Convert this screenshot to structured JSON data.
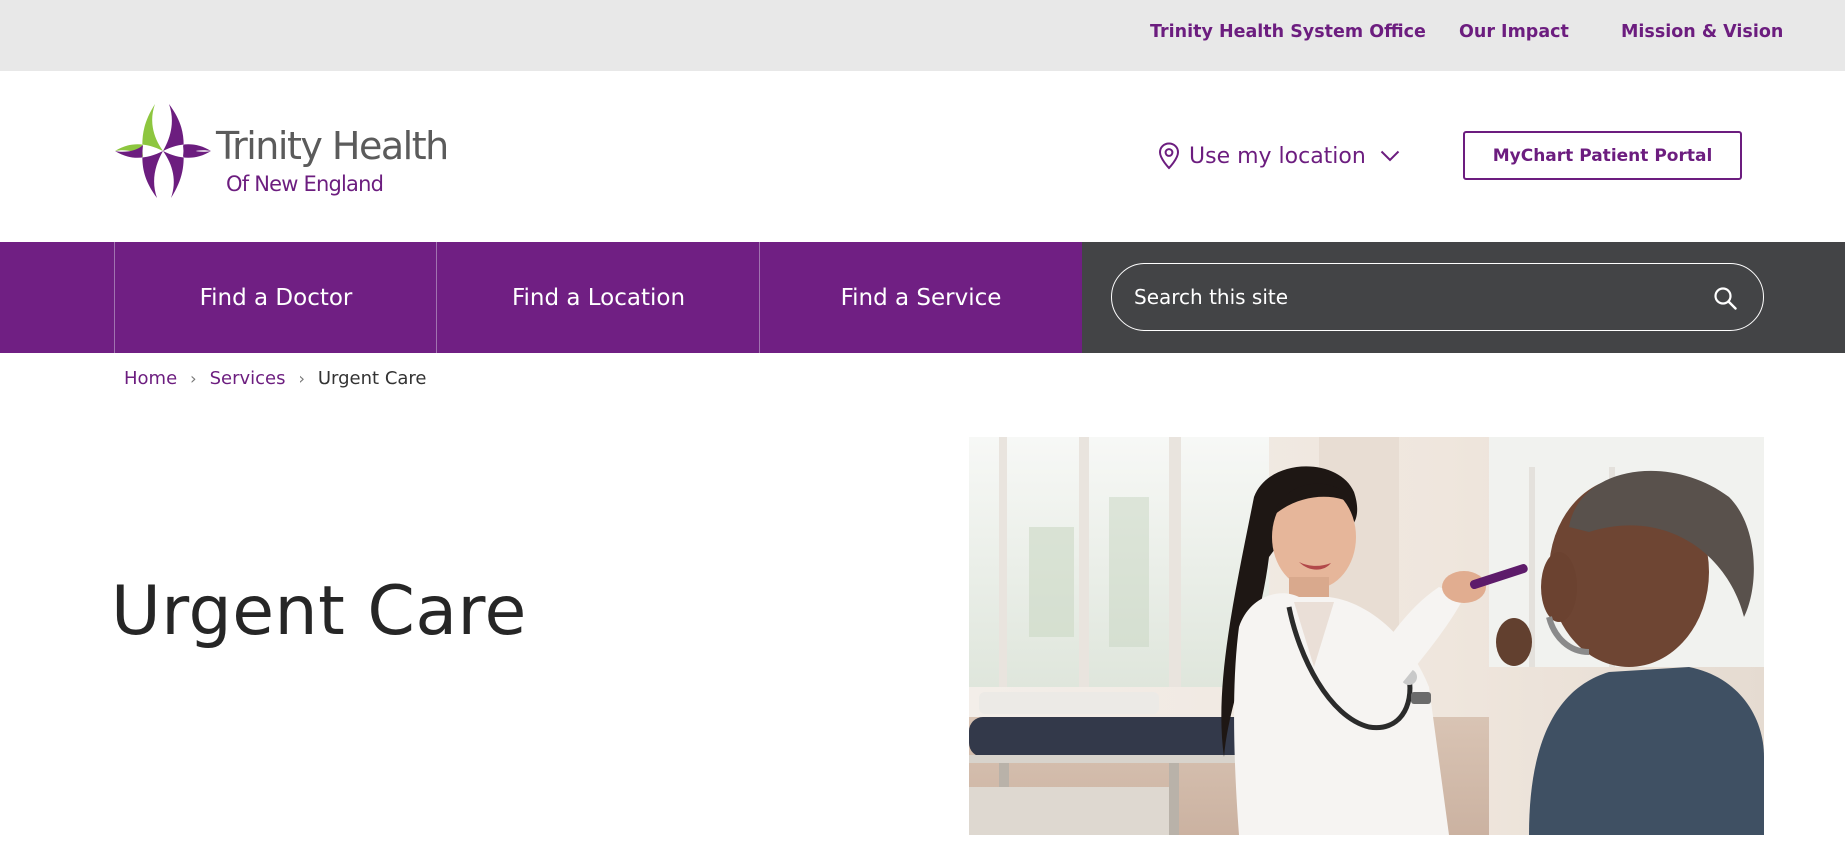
{
  "utility_nav": {
    "system_office": "Trinity Health System Office",
    "our_impact": "Our Impact",
    "mission_vision": "Mission & Vision"
  },
  "logo": {
    "line1": "Trinity Health",
    "line2": "Of New England",
    "colors": {
      "green": "#8dc63f",
      "purple": "#6c1d7f"
    }
  },
  "header": {
    "location_label": "Use my location",
    "portal_button": "MyChart Patient Portal"
  },
  "main_nav": {
    "items": [
      "Find a Doctor",
      "Find a Location",
      "Find a Service"
    ]
  },
  "search": {
    "placeholder": "Search this site",
    "icon": "search-icon"
  },
  "breadcrumb": {
    "items": [
      "Home",
      "Services"
    ],
    "current": "Urgent Care"
  },
  "hero": {
    "title": "Urgent Care",
    "image_alt": "Doctor examining a patient's throat"
  },
  "colors": {
    "brand_purple": "#701f83",
    "nav_dark": "#434446",
    "utility_bg": "#e8e8e8"
  }
}
